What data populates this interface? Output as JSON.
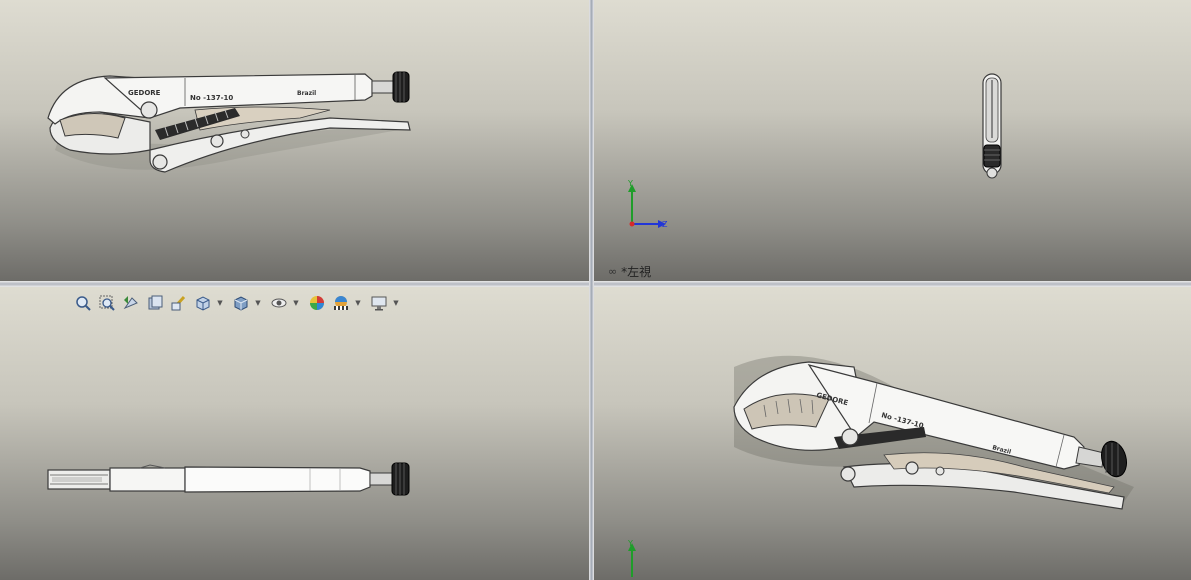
{
  "viewports": {
    "top_left": {
      "brand_text": "GEDORE",
      "model_text": "No -137-10",
      "maker_text": "Brazil"
    },
    "top_right": {
      "view_label": "*左視",
      "triad": {
        "y": "Y",
        "z": "Z"
      }
    },
    "bottom_left": {
      "toolbar": [
        {
          "name": "zoom-to-fit-icon"
        },
        {
          "name": "zoom-to-area-icon"
        },
        {
          "name": "previous-view-icon"
        },
        {
          "name": "section-view-icon"
        },
        {
          "name": "dynamic-annotation-icon"
        },
        {
          "name": "view-orientation-icon",
          "dropdown": true
        },
        {
          "name": "display-style-icon",
          "dropdown": true
        },
        {
          "name": "hide-show-items-icon",
          "dropdown": true
        },
        {
          "name": "edit-appearance-icon"
        },
        {
          "name": "apply-scene-icon",
          "dropdown": true
        },
        {
          "name": "view-settings-icon",
          "dropdown": true
        }
      ]
    },
    "bottom_right": {
      "brand_text": "GEDORE",
      "model_text": "No -137-10",
      "maker_text": "Brazil",
      "triad": {
        "y": "Y"
      }
    }
  },
  "colors": {
    "viewport_top": "#dedcd1",
    "viewport_bottom": "#6d6c68",
    "tool_body": "#f2f2f0",
    "tool_outline": "#3a3a3a",
    "tool_shadow": "#b8b4a8",
    "axis_y": "#1f9d2a",
    "axis_z": "#2236d8",
    "axis_x": "#d62a2a"
  }
}
